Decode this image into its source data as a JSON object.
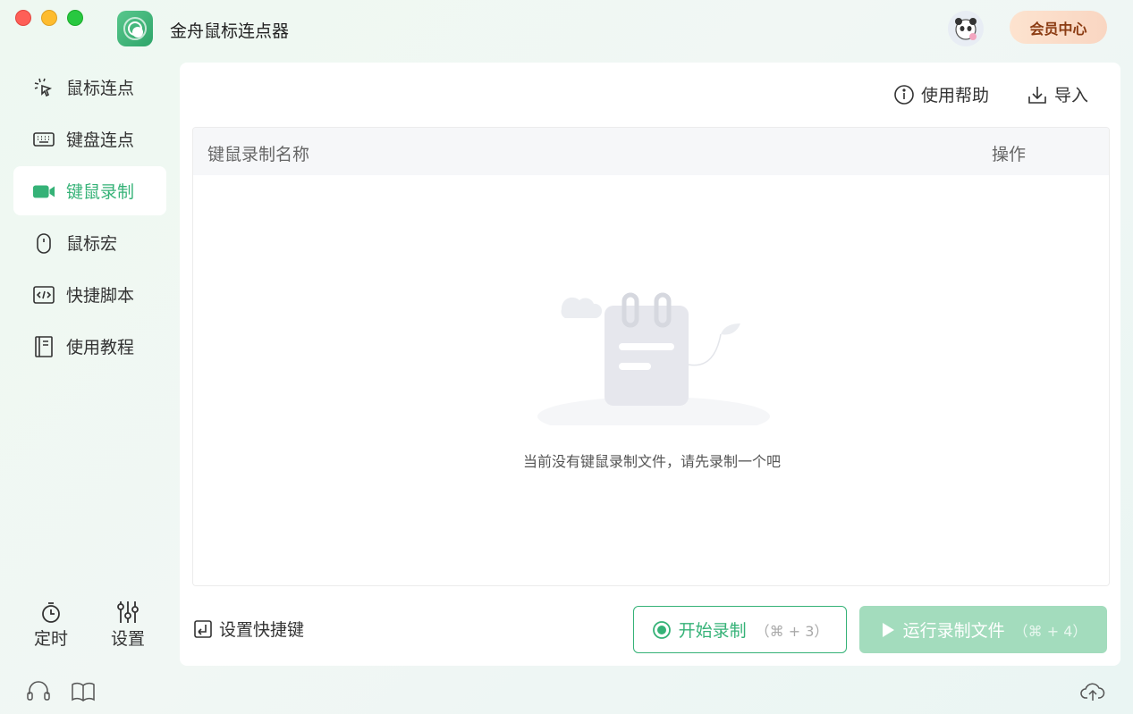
{
  "app": {
    "title": "金舟鼠标连点器",
    "vip_label": "会员中心"
  },
  "sidebar": {
    "items": [
      {
        "label": "鼠标连点",
        "icon": "mouse-click-icon"
      },
      {
        "label": "键盘连点",
        "icon": "keyboard-icon"
      },
      {
        "label": "键鼠录制",
        "icon": "video-record-icon",
        "active": true
      },
      {
        "label": "鼠标宏",
        "icon": "mouse-icon"
      },
      {
        "label": "快捷脚本",
        "icon": "code-icon"
      },
      {
        "label": "使用教程",
        "icon": "book-icon"
      }
    ],
    "tools": {
      "timer_label": "定时",
      "settings_label": "设置"
    }
  },
  "toolbar": {
    "help_label": "使用帮助",
    "import_label": "导入"
  },
  "table": {
    "columns": [
      "键鼠录制名称",
      "操作"
    ],
    "rows": [],
    "empty_text": "当前没有键鼠录制文件，请先录制一个吧"
  },
  "footer": {
    "shortcut_label": "设置快捷键",
    "record_label": "开始录制",
    "record_hint": "（⌘ + 3）",
    "run_label": "运行录制文件",
    "run_hint": "（⌘ + 4）"
  },
  "colors": {
    "accent": "#35b277",
    "accent_disabled": "#a3dcbd",
    "vip_text": "#8b3b12"
  }
}
